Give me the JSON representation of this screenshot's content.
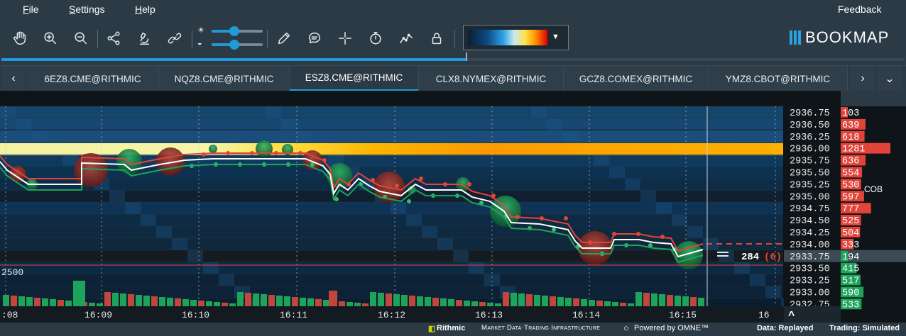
{
  "menu": {
    "items": [
      {
        "mnemonic": "F",
        "rest": "ile"
      },
      {
        "mnemonic": "S",
        "rest": "ettings"
      },
      {
        "mnemonic": "H",
        "rest": "elp"
      }
    ],
    "feedback": "Feedback"
  },
  "toolbar": {
    "icons": [
      "hand-icon",
      "zoom-in-icon",
      "zoom-out-icon",
      "share-icon",
      "microscope-icon",
      "link-icon",
      "brightness-icon",
      "contrast-icon",
      "pencil-icon",
      "chat-icon",
      "crosshair-icon",
      "timer-icon",
      "chart-line-icon",
      "lock-icon"
    ],
    "sliders": [
      {
        "name": "brightness",
        "level": 0.45
      },
      {
        "name": "contrast",
        "level": 0.45
      }
    ]
  },
  "logo": {
    "text": "BOOKMAP"
  },
  "replay": {
    "progress": 0.515
  },
  "tabs": {
    "items": [
      "6EZ8.CME@RITHMIC",
      "NQZ8.CME@RITHMIC",
      "ESZ8.CME@RITHMIC",
      "CLX8.NYMEX@RITHMIC",
      "GCZ8.COMEX@RITHMIC",
      "YMZ8.CBOT@RITHMIC"
    ],
    "active": 2,
    "prev": "‹",
    "next": "›",
    "more": "⌄"
  },
  "chart": {
    "volume_label": "2500",
    "last_price": "2933.75",
    "cursor_volume": "284",
    "cursor_count": "(6)",
    "time_labels": [
      ":08",
      "16:09",
      "16:10",
      "16:11",
      "16:12",
      "16:13",
      "16:14",
      "16:15",
      "16"
    ],
    "cob_title": "COB",
    "scroll_up": "^",
    "colors": {
      "bid": "#1ea35a",
      "ask": "#e2443a",
      "heat_high": "#ffb400",
      "heat_low": "#0b2a45"
    }
  },
  "ladder": [
    {
      "price": "2936.75",
      "size": "103",
      "side": "ask",
      "level": 0.08
    },
    {
      "price": "2936.50",
      "size": "639",
      "side": "ask",
      "level": 0.5
    },
    {
      "price": "2936.25",
      "size": "618",
      "side": "ask",
      "level": 0.48
    },
    {
      "price": "2936.00",
      "size": "1281",
      "side": "ask",
      "level": 1.0
    },
    {
      "price": "2935.75",
      "size": "636",
      "side": "ask",
      "level": 0.5
    },
    {
      "price": "2935.50",
      "size": "554",
      "side": "ask",
      "level": 0.43
    },
    {
      "price": "2935.25",
      "size": "530",
      "side": "ask",
      "level": 0.41
    },
    {
      "price": "2935.00",
      "size": "597",
      "side": "ask",
      "level": 0.47
    },
    {
      "price": "2934.75",
      "size": "777",
      "side": "ask",
      "level": 0.61
    },
    {
      "price": "2934.50",
      "size": "525",
      "side": "ask",
      "level": 0.41
    },
    {
      "price": "2934.25",
      "size": "504",
      "side": "ask",
      "level": 0.39
    },
    {
      "price": "2934.00",
      "size": "333",
      "side": "ask",
      "level": 0.26
    },
    {
      "price": "2933.75",
      "size": "194",
      "side": "bid",
      "level": 0.15
    },
    {
      "price": "2933.50",
      "size": "415",
      "side": "bid",
      "level": 0.32
    },
    {
      "price": "2933.25",
      "size": "517",
      "side": "bid",
      "level": 0.4
    },
    {
      "price": "2933.00",
      "size": "590",
      "side": "bid",
      "level": 0.46
    },
    {
      "price": "2932.75",
      "size": "533",
      "side": "bid",
      "level": 0.42
    }
  ],
  "footer": {
    "rithmic": "Rithmic",
    "rithmic_tag": "Market Data·Trading Infrastructure",
    "omne": "Powered by OMNE™",
    "data_status": "Data: Replayed",
    "trading_status": "Trading: Simulated"
  }
}
